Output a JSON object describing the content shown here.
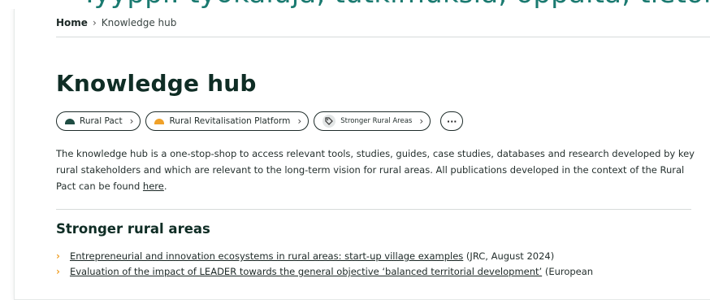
{
  "banner": {
    "text": "Tyyppi: työkaluja, tutkimuksia, oppaita, tietokantoja"
  },
  "breadcrumb": {
    "home": "Home",
    "current": "Knowledge hub"
  },
  "page": {
    "title": "Knowledge hub"
  },
  "tags": [
    {
      "label": "Rural Pact",
      "color": "#1f4d43"
    },
    {
      "label": "Rural Revitalisation Platform",
      "color": "#f0a129"
    },
    {
      "label": "Stronger Rural Areas"
    }
  ],
  "intro": {
    "text": "The knowledge hub is a one-stop-shop to access relevant tools, studies, guides, case studies, databases and research developed by key rural stakeholders and which are relevant to the long-term vision for rural areas. All publications developed in the context of the Rural Pact can be found ",
    "link": "here",
    "end": "."
  },
  "section": {
    "title": "Stronger rural areas",
    "items": [
      {
        "link": "Entrepreneurial and innovation ecosystems in rural areas: start-up village examples",
        "suffix": " (JRC, August 2024)"
      },
      {
        "link": "Evaluation of the impact of LEADER towards the general objective ‘balanced territorial development’",
        "suffix": " (European"
      }
    ]
  }
}
